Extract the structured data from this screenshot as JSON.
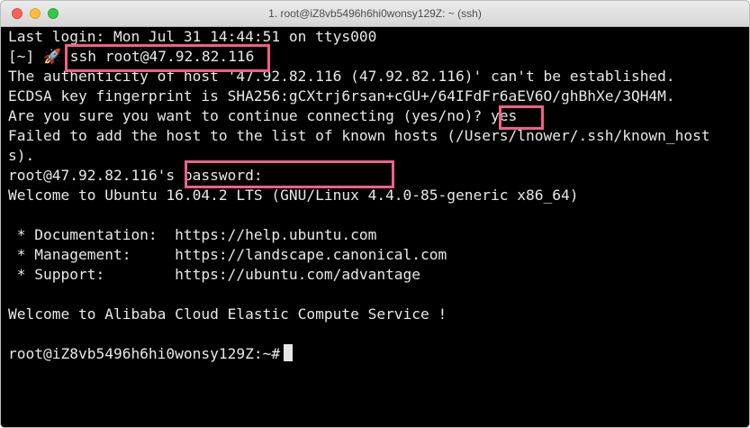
{
  "window": {
    "title": "1. root@iZ8vb5496h6hi0wonsy129Z: ~ (ssh)",
    "highlight_color": "#f0608a"
  },
  "terminal": {
    "lines": [
      "Last login: Mon Jul 31 14:44:51 on ttys000",
      "The authenticity of host '47.92.82.116 (47.92.82.116)' can't be established.",
      "ECDSA key fingerprint is SHA256:gCXtrj6rsan+cGU+/64IFdFr6aEV6O/ghBhXe/3QH4M.",
      "Are you sure you want to continue connecting (yes/no)? yes",
      "Failed to add the host to the list of known hosts (/Users/lnower/.ssh/known_host",
      "s).",
      "root@47.92.82.116's password:",
      "Welcome to Ubuntu 16.04.2 LTS (GNU/Linux 4.4.0-85-generic x86_64)",
      "",
      " * Documentation:  https://help.ubuntu.com",
      " * Management:     https://landscape.canonical.com",
      " * Support:        https://ubuntu.com/advantage",
      "",
      "Welcome to Alibaba Cloud Elastic Compute Service !",
      ""
    ],
    "prompt_line": {
      "dir": "[~]",
      "icon": "rocket-icon",
      "command": "ssh root@47.92.82.116"
    },
    "final_prompt": "root@iZ8vb5496h6hi0wonsy129Z:~#"
  }
}
